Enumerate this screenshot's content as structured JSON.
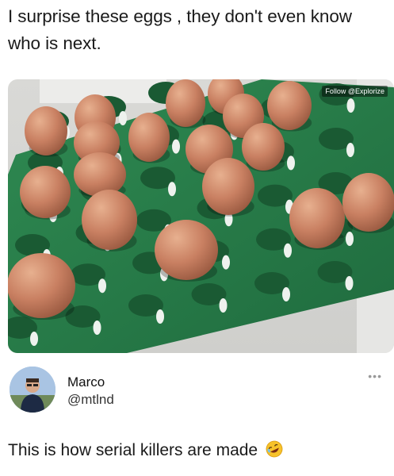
{
  "caption": "I surprise these eggs , they don't even know who is next.",
  "photo": {
    "watermark": "Follow @Explorize"
  },
  "author": {
    "name": "Marco",
    "handle": "@mtlnd",
    "more_icon": "ellipsis-icon"
  },
  "tweet": {
    "text": "This is how serial killers are made",
    "emoji": "rolling-on-floor-laughing-emoji"
  }
}
